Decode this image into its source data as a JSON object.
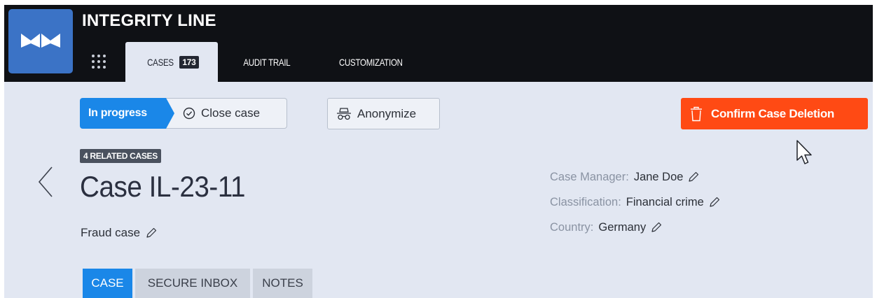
{
  "app": {
    "title": "INTEGRITY LINE",
    "logo_icon": "integrity-line-logo",
    "apps_icon": "apps-grid-icon"
  },
  "nav": {
    "tabs": [
      {
        "label": "CASES",
        "badge": "173",
        "active": true
      },
      {
        "label": "AUDIT TRAIL",
        "active": false
      },
      {
        "label": "CUSTOMIZATION",
        "active": false
      }
    ]
  },
  "toolbar": {
    "status_label": "In progress",
    "close_case_label": "Close case",
    "anonymize_label": "Anonymize",
    "confirm_delete_label": "Confirm Case Deletion"
  },
  "case": {
    "related_badge": "4 RELATED CASES",
    "title": "Case IL-23-11",
    "type": "Fraud case"
  },
  "meta": {
    "manager_label": "Case Manager:",
    "manager_value": "Jane Doe",
    "classification_label": "Classification:",
    "classification_value": "Financial crime",
    "country_label": "Country:",
    "country_value": "Germany"
  },
  "subtabs": [
    {
      "label": "CASE",
      "active": true
    },
    {
      "label": "SECURE INBOX",
      "active": false
    },
    {
      "label": "NOTES",
      "active": false
    }
  ],
  "colors": {
    "accent": "#1a87e8",
    "danger": "#ff4a14",
    "topbar": "#0f1115",
    "background": "#e2e7f2"
  }
}
